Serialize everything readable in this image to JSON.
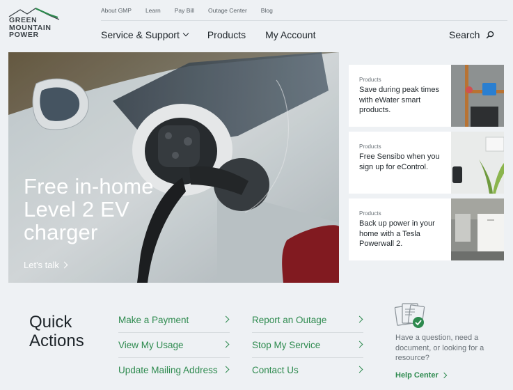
{
  "logo": {
    "lines": [
      "GREEN",
      "MOUNTAIN",
      "POWER"
    ]
  },
  "util_nav": [
    "About GMP",
    "Learn",
    "Pay Bill",
    "Outage Center",
    "Blog"
  ],
  "main_nav": {
    "service": "Service & Support",
    "products": "Products",
    "account": "My Account"
  },
  "search": {
    "label": "Search",
    "icon": "search-icon"
  },
  "hero": {
    "title_lines": [
      "Free in-home",
      "Level 2 EV",
      "charger"
    ],
    "cta": "Let's talk"
  },
  "cards": [
    {
      "tag": "Products",
      "desc": "Save during peak times with eWater smart products."
    },
    {
      "tag": "Products",
      "desc": "Free Sensibo when you sign up for eControl."
    },
    {
      "tag": "Products",
      "desc": "Back up power in your home with a Tesla Powerwall 2."
    }
  ],
  "quick_actions": {
    "title_lines": [
      "Quick",
      "Actions"
    ],
    "links": [
      "Make a Payment",
      "View My Usage",
      "Update Mailing Address",
      "Report an Outage",
      "Stop My Service",
      "Contact Us"
    ]
  },
  "help": {
    "text": "Have a question, need a document, or looking for a resource?",
    "link": "Help Center"
  },
  "colors": {
    "brand_green": "#2d8a4e",
    "background": "#eef1f4"
  }
}
